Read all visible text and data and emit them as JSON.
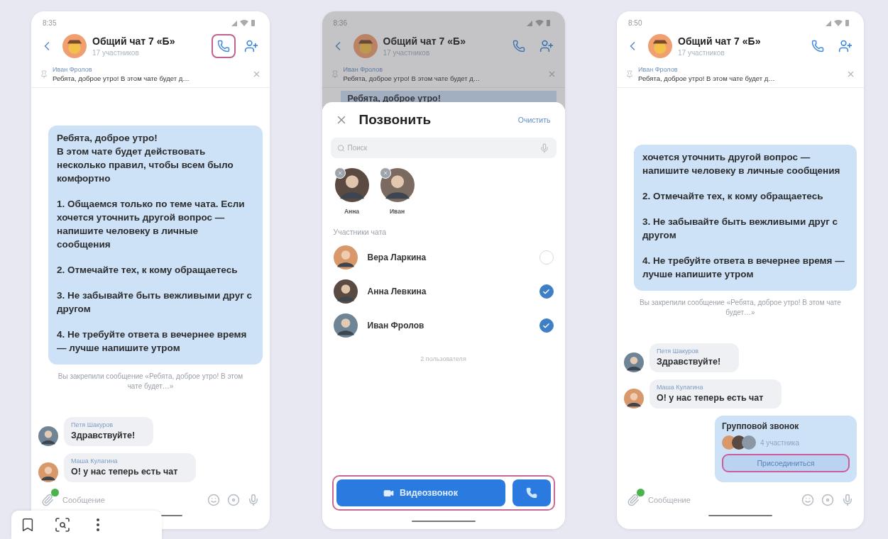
{
  "screens": [
    {
      "kind": "chat",
      "status_time": "8:35",
      "header": {
        "title": "Общий чат 7 «Б»",
        "subtitle": "17 участников",
        "call_highlighted": true
      },
      "pinned": {
        "author": "Иван Фролов",
        "text": "Ребята, доброе утро! В этом чате будет д…"
      },
      "feed": [
        {
          "kind": "message",
          "blocks": [
            [
              "Ребята, доброе утро!",
              "В этом чате будет действовать несколько правил, чтобы всем было комфортно"
            ],
            [
              "1. Общаемся только по теме чата. Если хочется уточнить другой вопрос — напишите человеку в личные сообщения"
            ],
            [
              "2. Отмечайте тех, к кому обращаетесь"
            ],
            [
              "3. Не забывайте быть вежливыми друг с другом"
            ],
            [
              "4. Не требуйте ответа в вечернее время — лучше напишите утром"
            ]
          ]
        },
        {
          "kind": "system",
          "text": "Вы закрепили сообщение «Ребята, доброе утро! В этом чате будет…»"
        },
        {
          "kind": "incoming",
          "author": "Петя Шакуров",
          "text": "Здравствуйте!"
        },
        {
          "kind": "incoming",
          "author": "Маша Кулагина",
          "text": "О! у нас теперь есть чат"
        }
      ],
      "composer": {
        "placeholder": "Сообщение"
      }
    },
    {
      "kind": "call_picker",
      "status_time": "8:36",
      "header": {
        "title": "Общий чат 7 «Б»",
        "subtitle": "17 участников",
        "call_highlighted": false
      },
      "pinned": {
        "author": "Иван Фролов",
        "text": "Ребята, доброе утро! В этом чате будет д…"
      },
      "peek": "Ребята, доброе утро!",
      "sheet": {
        "title": "Позвонить",
        "clear": "Очистить",
        "search": {
          "placeholder": "Поиск"
        },
        "chips": [
          {
            "name": "Анна"
          },
          {
            "name": "Иван"
          }
        ],
        "section": "Участники чата",
        "members": [
          {
            "name": "Вера Ларкина",
            "checked": false
          },
          {
            "name": "Анна Левкина",
            "checked": true
          },
          {
            "name": "Иван Фролов",
            "checked": true
          }
        ],
        "count": "2 пользователя",
        "video_button": "Видеозвонок",
        "buttons_highlighted": true
      }
    },
    {
      "kind": "chat",
      "status_time": "8:50",
      "header": {
        "title": "Общий чат 7 «Б»",
        "subtitle": "17 участников",
        "call_highlighted": false
      },
      "pinned": {
        "author": "Иван Фролов",
        "text": "Ребята, доброе утро! В этом чате будет д…"
      },
      "feed": [
        {
          "kind": "message",
          "blocks": [
            [
              "хочется уточнить другой вопрос — напишите человеку в личные сообщения"
            ],
            [
              "2. Отмечайте тех, к кому обращаетесь"
            ],
            [
              "3. Не забывайте быть вежливыми друг с другом"
            ],
            [
              "4. Не требуйте ответа в вечернее время — лучше напишите утром"
            ]
          ]
        },
        {
          "kind": "system",
          "text": "Вы закрепили сообщение «Ребята, доброе утро! В этом чате будет…»"
        },
        {
          "kind": "incoming",
          "author": "Петя Шакуров",
          "text": "Здравствуйте!"
        },
        {
          "kind": "incoming",
          "author": "Маша Кулагина",
          "text": "О! у нас теперь есть чат"
        },
        {
          "kind": "group_call",
          "title": "Групповой звонок",
          "participants": "4 участника",
          "join": "Присоединиться",
          "join_highlighted": true
        }
      ],
      "composer": {
        "placeholder": "Сообщение"
      }
    }
  ]
}
